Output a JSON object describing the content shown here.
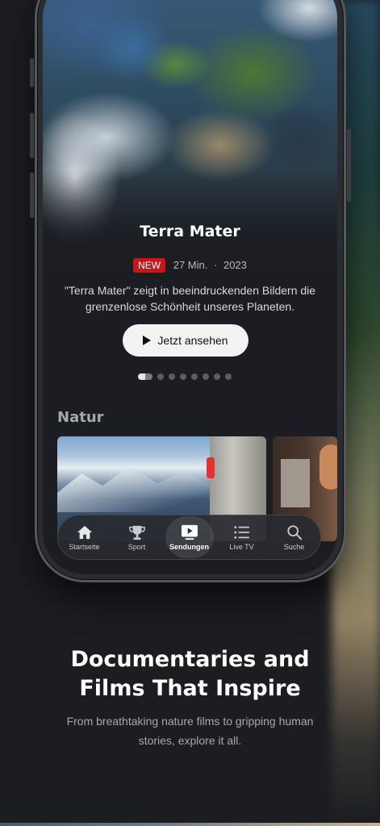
{
  "hero": {
    "title": "Terra Mater",
    "badge": "NEW",
    "duration": "27 Min.",
    "separator": "·",
    "year": "2023",
    "description": "\"Terra Mater\" zeigt in beeindruckenden Bildern die grenzenlose Schönheit unseres Planeten.",
    "watch_label": "Jetzt ansehen",
    "carousel": {
      "count": 8,
      "active_index": 0
    }
  },
  "section": {
    "title": "Natur"
  },
  "tabbar": {
    "items": [
      {
        "label": "Startseite",
        "icon": "home-icon",
        "active": false
      },
      {
        "label": "Sport",
        "icon": "trophy-icon",
        "active": false
      },
      {
        "label": "Sendungen",
        "icon": "play-screen-icon",
        "active": true
      },
      {
        "label": "Live TV",
        "icon": "list-icon",
        "active": false
      },
      {
        "label": "Suche",
        "icon": "search-icon",
        "active": false
      }
    ]
  },
  "promo": {
    "headline_line1": "Documentaries and",
    "headline_line2": "Films That Inspire",
    "subline": "From breathtaking nature films to gripping human stories, explore it all."
  },
  "colors": {
    "background": "#1b1d21",
    "badge_red": "#c9161c",
    "button_bg": "#f3f3f3"
  }
}
